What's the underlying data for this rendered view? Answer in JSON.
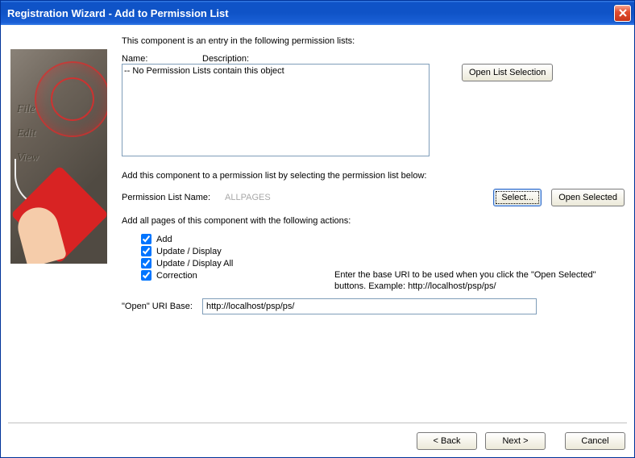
{
  "window": {
    "title": "Registration Wizard - Add to Permission List"
  },
  "intro": "This component is an entry in the following permission lists:",
  "list": {
    "header_name": "Name:",
    "header_desc": "Description:",
    "empty_text": "-- No Permission Lists contain this object"
  },
  "buttons": {
    "open_list_selection": "Open List Selection",
    "select": "Select...",
    "open_selected": "Open Selected",
    "back": "< Back",
    "next": "Next >",
    "cancel": "Cancel"
  },
  "add_hint": "Add this component to a permission list by selecting the permission list below:",
  "perm_list_name_label": "Permission List Name:",
  "perm_list_name_value": "ALLPAGES",
  "actions_hint": "Add all pages of this component with the following actions:",
  "actions": {
    "add": {
      "label": "Add",
      "checked": true
    },
    "update_display": {
      "label": "Update / Display",
      "checked": true
    },
    "update_display_all": {
      "label": "Update / Display All",
      "checked": true
    },
    "correction": {
      "label": "Correction",
      "checked": true
    }
  },
  "uri_hint": "Enter the base URI to be used when you click the \"Open Selected\" buttons.  Example:   http://localhost/psp/ps/",
  "uri_label": "\"Open\" URI Base:",
  "uri_value": "http://localhost/psp/ps/"
}
